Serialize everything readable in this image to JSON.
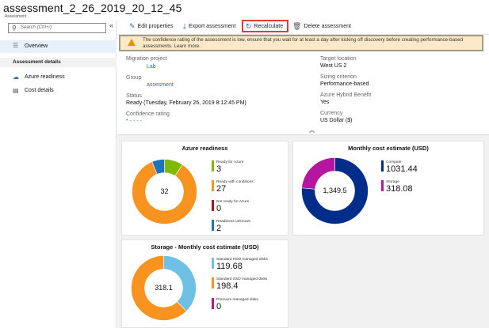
{
  "header": {
    "title": "assessment_2_26_2019_20_12_45",
    "subtitle": "Assessment"
  },
  "sidebar": {
    "search_placeholder": "Search (Ctrl+/)",
    "collapse_glyph": "«",
    "overview_label": "Overview",
    "section_title": "Assessment details",
    "items": [
      {
        "label": "Azure readiness",
        "icon": "azure-readiness-icon"
      },
      {
        "label": "Cost details",
        "icon": "cost-details-icon"
      }
    ]
  },
  "toolbar": {
    "edit_label": "Edit properties",
    "export_label": "Export assessment",
    "recalc_label": "Recalculate",
    "delete_label": "Delete assessment"
  },
  "warning": {
    "text": "The confidence rating of the assessment is low, ensure that you wait for at least a day after kicking off discovery before creating performance-based assessments. Learn more."
  },
  "essentials": {
    "migration_project_label": "Migration project",
    "migration_project_value": "Lab",
    "group_label": "Group",
    "group_value": "assesment",
    "status_label": "Status",
    "status_value": "Ready (Tuesday, February 26, 2019 8:12:45 PM)",
    "confidence_label": "Confidence rating",
    "confidence_value": "* - - - -",
    "target_label": "Target location",
    "target_value": "West US 2",
    "sizing_label": "Sizing criterion",
    "sizing_value": "Performance-based",
    "hybrid_label": "Azure Hybrid Benefit",
    "hybrid_value": "Yes",
    "currency_label": "Currency",
    "currency_value": "US Dollar ($)"
  },
  "colors": {
    "orange": "#f7931e",
    "green": "#7fba00",
    "red": "#b4121b",
    "blue": "#1e73be",
    "navy": "#002c8a",
    "magenta": "#b4169f",
    "lightblue": "#6ec1e4"
  },
  "chart_data": [
    {
      "type": "pie",
      "title": "Azure readiness",
      "center_label": "32",
      "categories": [
        "Ready for Azure",
        "Ready with conditions",
        "Not ready for Azure",
        "Readiness unknown"
      ],
      "values": [
        3,
        27,
        0,
        2
      ],
      "value_labels": [
        "3",
        "27",
        "0",
        "2"
      ],
      "colors": [
        "#7fba00",
        "#f7931e",
        "#b4121b",
        "#1e73be"
      ]
    },
    {
      "type": "pie",
      "title": "Monthly cost estimate (USD)",
      "center_label": "1,349.5",
      "categories": [
        "Compute",
        "Storage"
      ],
      "values": [
        1031.44,
        318.08
      ],
      "value_labels": [
        "1031.44",
        "318.08"
      ],
      "colors": [
        "#002c8a",
        "#b4169f"
      ]
    },
    {
      "type": "pie",
      "title": "Storage - Monthly cost estimate (USD)",
      "center_label": "318.1",
      "categories": [
        "Standard HDD managed disks",
        "Standard SSD managed disks",
        "Premium managed disks"
      ],
      "values": [
        119.68,
        198.4,
        0
      ],
      "value_labels": [
        "119.68",
        "198.4",
        "0"
      ],
      "colors": [
        "#6ec1e4",
        "#f7931e",
        "#b4169f"
      ]
    }
  ]
}
